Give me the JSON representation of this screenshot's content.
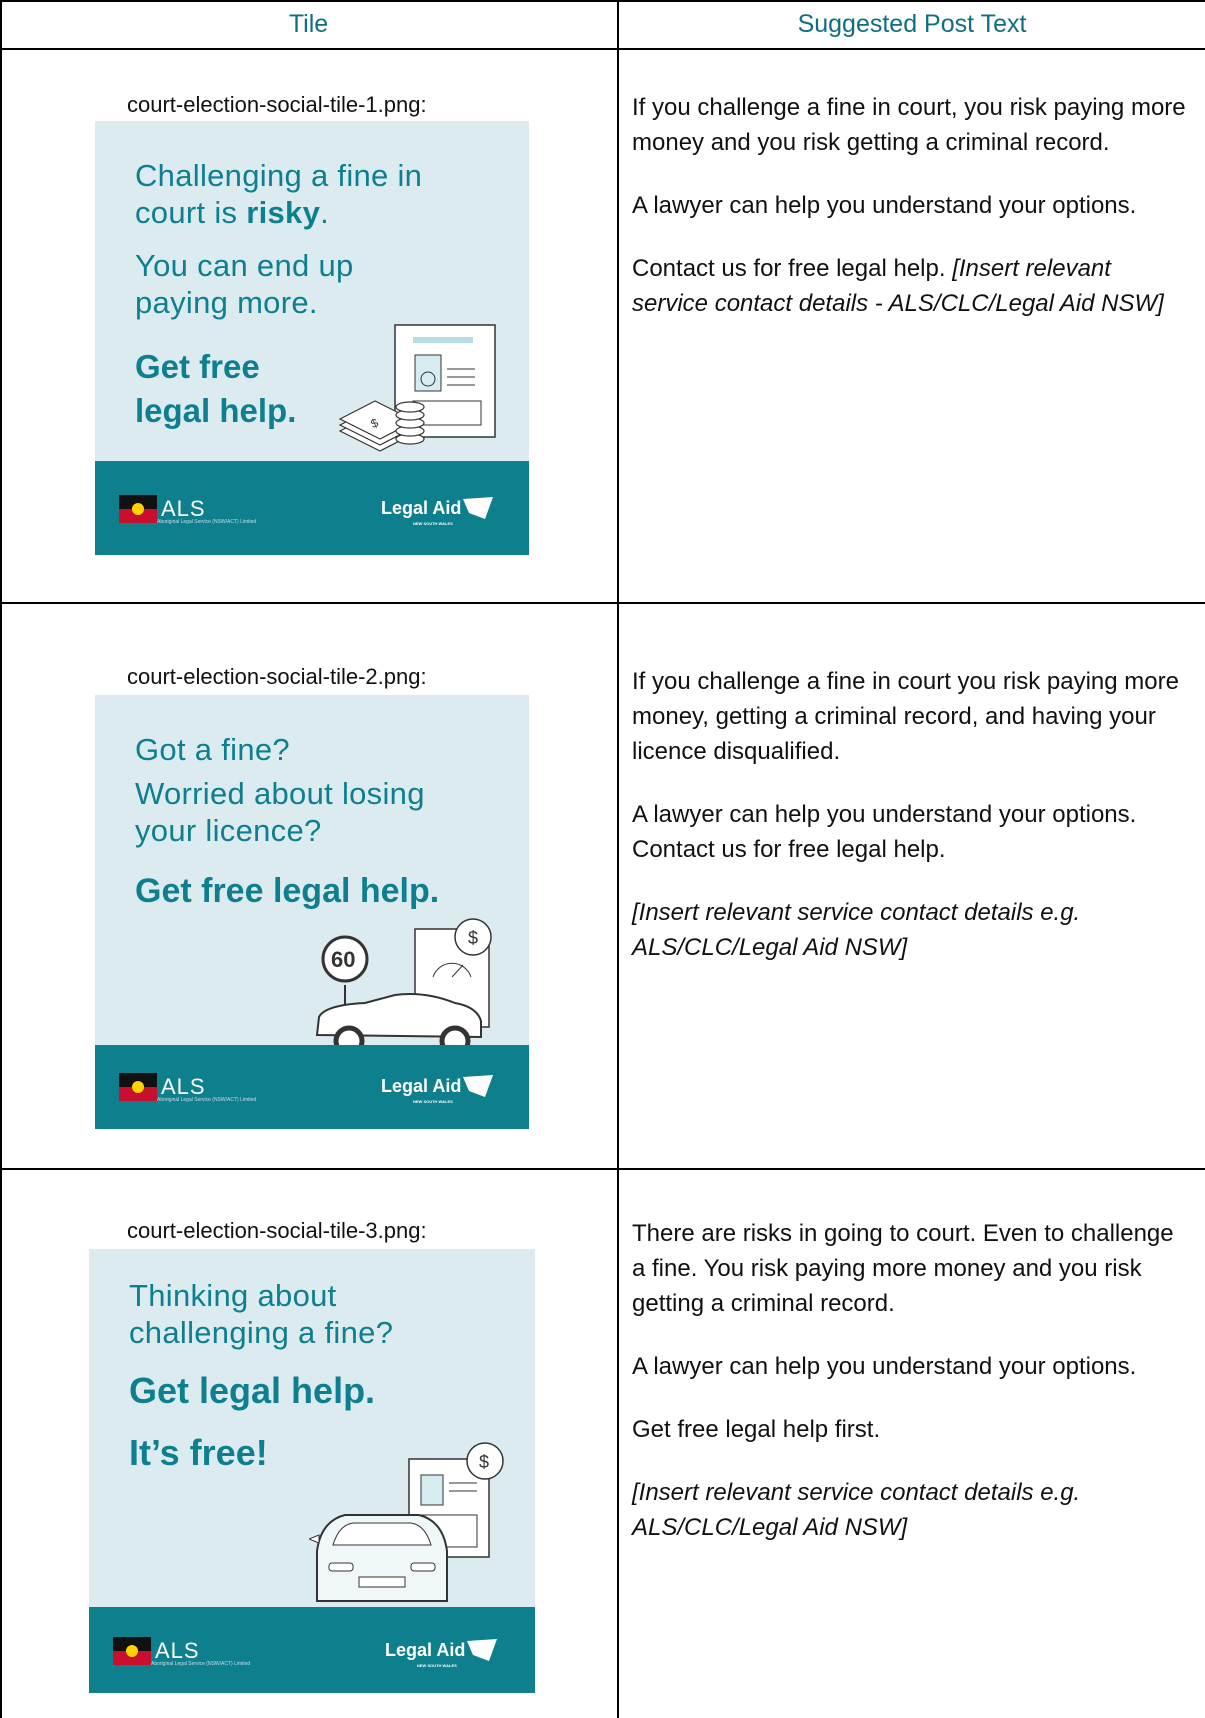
{
  "headers": {
    "tile": "Tile",
    "post": "Suggested Post Text"
  },
  "colors": {
    "teal_text": "#0e7f8f",
    "tile_bg": "#dcebef",
    "band": "#0d7f8d",
    "header_text": "#0f6f80"
  },
  "rows": [
    {
      "filename": "court-election-social-tile-1.png:",
      "tile": {
        "line1": "Challenging a fine in",
        "line2_pre": "court is ",
        "line2_bold": "risky",
        "line2_post": ".",
        "line3": "You can end up",
        "line4": "paying more.",
        "cta1": "Get free",
        "cta2": "legal help.",
        "illustration": "document-and-money-icon"
      },
      "post": {
        "p1": "If you challenge a fine in court, you risk paying more money and you risk getting a criminal record.",
        "p2": "A lawyer can help you understand your options.",
        "p3": "Contact us for free legal help. ",
        "p3_italic": "[Insert relevant service contact details - ALS/CLC/Legal Aid NSW]"
      }
    },
    {
      "filename": "court-election-social-tile-2.png:",
      "tile": {
        "line1": "Got a fine?",
        "line2": "Worried about losing",
        "line3": "your licence?",
        "cta1": "Get free legal help.",
        "sign": "60",
        "coin": "$",
        "illustration": "car-speed-sign-icon"
      },
      "post": {
        "p1": "If you challenge a fine in court you risk paying more money, getting a criminal record, and having your licence disqualified.",
        "p2": "A lawyer can help you understand your options. Contact us for free legal help.",
        "p3_italic": "[Insert relevant service contact details e.g. ALS/CLC/Legal Aid NSW]"
      }
    },
    {
      "filename": "court-election-social-tile-3.png:",
      "tile": {
        "line1": "Thinking about",
        "line2": "challenging a fine?",
        "cta1": "Get legal help.",
        "cta2": "It’s free!",
        "coin": "$",
        "illustration": "car-front-document-icon"
      },
      "post": {
        "p1": "There are risks in going to court. Even to challenge a fine. You risk paying more money and you risk getting a criminal record.",
        "p2": "A lawyer can help you understand your options.",
        "p3": "Get free legal help first.",
        "p4_italic": "[Insert relevant service contact details e.g. ALS/CLC/Legal Aid NSW]"
      }
    }
  ],
  "logos": {
    "als_word": "ALS",
    "als_sub": "Aboriginal Legal Service (NSW/ACT) Limited",
    "la_word": "Legal Aid",
    "la_sub": "NEW SOUTH WALES"
  }
}
